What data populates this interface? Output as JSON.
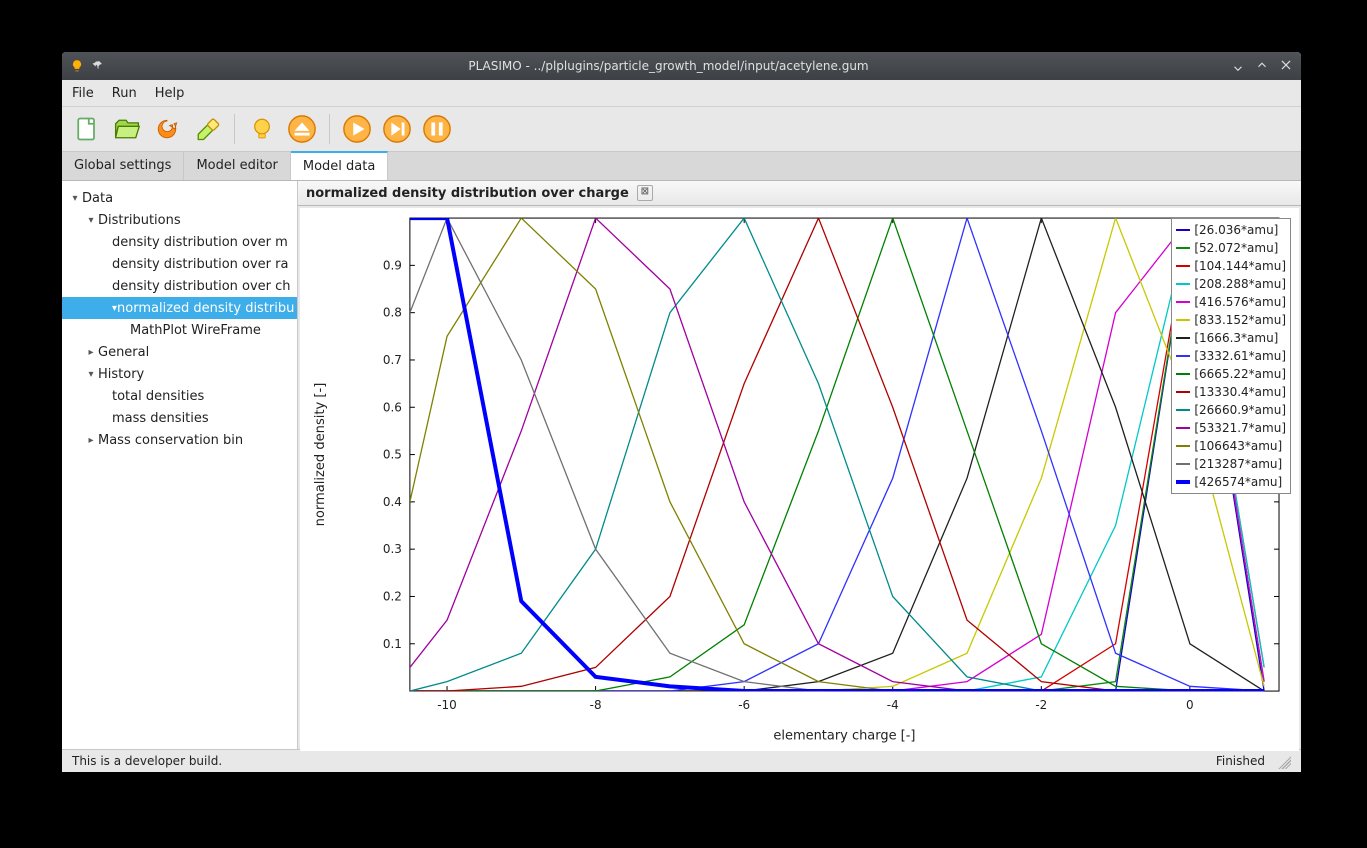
{
  "window": {
    "title": "PLASIMO - ../plplugins/particle_growth_model/input/acetylene.gum"
  },
  "menu": {
    "file": "File",
    "run": "Run",
    "help": "Help"
  },
  "tabs": {
    "global": "Global settings",
    "editor": "Model editor",
    "data": "Model data"
  },
  "tree": {
    "root": "Data",
    "distributions": "Distributions",
    "d1": "density distribution over m",
    "d2": "density distribution over ra",
    "d3": "density distribution over ch",
    "d4": "normalized density distribu",
    "d4c": "MathPlot WireFrame",
    "general": "General",
    "history": "History",
    "h1": "total densities",
    "h2": "mass densities",
    "mass": "Mass conservation bin"
  },
  "content_tab": "normalized density distribution over charge",
  "status": {
    "left": "This is a developer build.",
    "right": "Finished"
  },
  "chart_data": {
    "type": "line",
    "title": "",
    "xlabel": "elementary charge [-]",
    "ylabel": "normalized density [-]",
    "xlim": [
      -10.5,
      1.2
    ],
    "ylim": [
      0,
      1.0
    ],
    "x": [
      -10.5,
      -10,
      -9,
      -8,
      -7,
      -6,
      -5,
      -4,
      -3,
      -2,
      -1,
      0,
      1
    ],
    "series": [
      {
        "name": "[26.036*amu]",
        "color": "#1400c8",
        "values": [
          0.0,
          0.0,
          0.0,
          0.0,
          0.0,
          0.0,
          0.0,
          0.0,
          0.0,
          0.0,
          0.0,
          1.0,
          0.0
        ]
      },
      {
        "name": "[52.072*amu]",
        "color": "#0a8a0a",
        "values": [
          0.0,
          0.0,
          0.0,
          0.0,
          0.0,
          0.0,
          0.0,
          0.0,
          0.0,
          0.0,
          0.02,
          1.0,
          0.02
        ]
      },
      {
        "name": "[104.144*amu]",
        "color": "#d40000",
        "values": [
          0.0,
          0.0,
          0.0,
          0.0,
          0.0,
          0.0,
          0.0,
          0.0,
          0.0,
          0.0,
          0.1,
          1.0,
          0.05
        ]
      },
      {
        "name": "[208.288*amu]",
        "color": "#00c8c8",
        "values": [
          0.0,
          0.0,
          0.0,
          0.0,
          0.0,
          0.0,
          0.0,
          0.0,
          0.0,
          0.03,
          0.35,
          1.0,
          0.05
        ]
      },
      {
        "name": "[416.576*amu]",
        "color": "#d400d4",
        "values": [
          0.0,
          0.0,
          0.0,
          0.0,
          0.0,
          0.0,
          0.0,
          0.0,
          0.02,
          0.12,
          0.8,
          1.0,
          0.02
        ]
      },
      {
        "name": "[833.152*amu]",
        "color": "#c8c800",
        "values": [
          0.0,
          0.0,
          0.0,
          0.0,
          0.0,
          0.0,
          0.0,
          0.01,
          0.08,
          0.45,
          1.0,
          0.6,
          0.01
        ]
      },
      {
        "name": "[1666.3*amu]",
        "color": "#202020",
        "values": [
          0.0,
          0.0,
          0.0,
          0.0,
          0.0,
          0.0,
          0.02,
          0.08,
          0.45,
          1.0,
          0.6,
          0.1,
          0.0
        ]
      },
      {
        "name": "[3332.61*amu]",
        "color": "#3030ff",
        "values": [
          0.0,
          0.0,
          0.0,
          0.0,
          0.0,
          0.02,
          0.1,
          0.45,
          1.0,
          0.55,
          0.08,
          0.01,
          0.0
        ]
      },
      {
        "name": "[6665.22*amu]",
        "color": "#008000",
        "values": [
          0.0,
          0.0,
          0.0,
          0.0,
          0.03,
          0.14,
          0.55,
          1.0,
          0.55,
          0.1,
          0.01,
          0.0,
          0.0
        ]
      },
      {
        "name": "[13330.4*amu]",
        "color": "#b00000",
        "values": [
          0.0,
          0.0,
          0.01,
          0.05,
          0.2,
          0.65,
          1.0,
          0.6,
          0.15,
          0.02,
          0.0,
          0.0,
          0.0
        ]
      },
      {
        "name": "[26660.9*amu]",
        "color": "#008b8b",
        "values": [
          0.0,
          0.02,
          0.08,
          0.3,
          0.8,
          1.0,
          0.65,
          0.2,
          0.03,
          0.0,
          0.0,
          0.0,
          0.0
        ]
      },
      {
        "name": "[53321.7*amu]",
        "color": "#a000a0",
        "values": [
          0.05,
          0.15,
          0.55,
          1.0,
          0.85,
          0.4,
          0.1,
          0.02,
          0.0,
          0.0,
          0.0,
          0.0,
          0.0
        ]
      },
      {
        "name": "[106643*amu]",
        "color": "#808000",
        "values": [
          0.4,
          0.75,
          1.0,
          0.85,
          0.4,
          0.1,
          0.02,
          0.0,
          0.0,
          0.0,
          0.0,
          0.0,
          0.0
        ]
      },
      {
        "name": "[213287*amu]",
        "color": "#707070",
        "values": [
          0.8,
          1.0,
          0.7,
          0.3,
          0.08,
          0.02,
          0.0,
          0.0,
          0.0,
          0.0,
          0.0,
          0.0,
          0.0
        ]
      },
      {
        "name": "[426574*amu]",
        "color": "#0000ff",
        "values": [
          1.0,
          1.0,
          0.19,
          0.03,
          0.01,
          0.0,
          0.0,
          0.0,
          0.0,
          0.0,
          0.0,
          0.0,
          0.0
        ],
        "thick": true
      }
    ],
    "xticks": [
      -10,
      -8,
      -6,
      -4,
      -2,
      0
    ],
    "yticks": [
      0.1,
      0.2,
      0.3,
      0.4,
      0.5,
      0.6,
      0.7,
      0.8,
      0.9
    ]
  }
}
